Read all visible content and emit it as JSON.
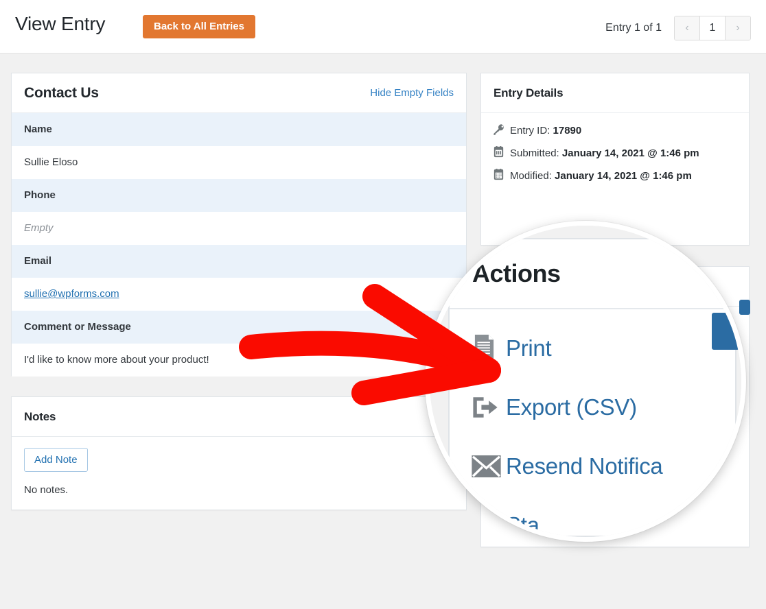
{
  "topbar": {
    "title": "View Entry",
    "back_button": "Back to All Entries",
    "pager_label": "Entry 1 of 1",
    "prev_icon": "‹",
    "page_number": "1",
    "next_icon": "›"
  },
  "form_panel": {
    "title": "Contact Us",
    "hide_empty_link": "Hide Empty Fields",
    "fields": [
      {
        "label": "Name",
        "value": "Sullie Eloso",
        "type": "text"
      },
      {
        "label": "Phone",
        "value": "Empty",
        "type": "empty"
      },
      {
        "label": "Email",
        "value": "sullie@wpforms.com",
        "type": "link"
      },
      {
        "label": "Comment or Message",
        "value": "I'd like to know more about your product!",
        "type": "text"
      }
    ]
  },
  "notes_panel": {
    "title": "Notes",
    "add_note_button": "Add Note",
    "no_notes_text": "No notes."
  },
  "entry_details": {
    "title": "Entry Details",
    "rows": [
      {
        "icon": "key-icon",
        "label": "Entry ID:",
        "value": "17890"
      },
      {
        "icon": "calendar-icon",
        "label": "Submitted:",
        "value": "January 14, 2021 @ 1:46 pm"
      },
      {
        "icon": "calendar-icon",
        "label": "Modified:",
        "value": "January 14, 2021 @ 1:46 pm"
      }
    ]
  },
  "actions_panel": {
    "title": "Actions",
    "items": [
      {
        "icon": "print-page-icon",
        "label": "Print"
      },
      {
        "icon": "export-arrow-icon",
        "label": "Export (CSV)"
      },
      {
        "icon": "envelope-icon",
        "label": "Resend Notifica"
      },
      {
        "icon": "star-icon",
        "label": "Sta"
      }
    ]
  },
  "annotation": {
    "arrow_color": "#FA0B00",
    "description": "red-arrow-pointing-to-print-action",
    "magnifier": "circular-zoom-lens-over-actions-panel"
  },
  "colors": {
    "accent_orange": "#e27730",
    "link_blue": "#2b6ca3",
    "field_label_bg": "#eaf2fa",
    "page_bg": "#f1f1f1"
  }
}
